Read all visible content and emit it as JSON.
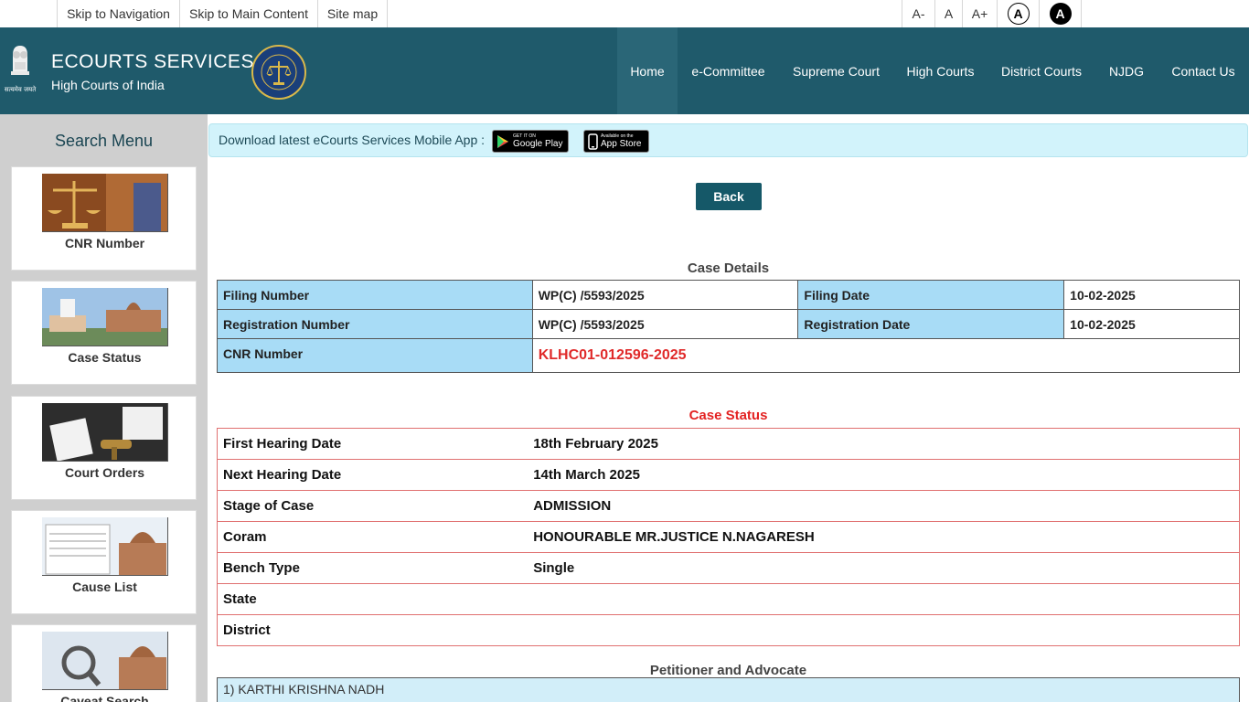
{
  "topbar": {
    "skip_navigation": "Skip to Navigation",
    "skip_main": "Skip to Main Content",
    "site_map": "Site map",
    "font_decrease": "A-",
    "font_normal": "A",
    "font_increase": "A+",
    "contrast_normal": "A",
    "contrast_high": "A"
  },
  "header": {
    "title": "ECOURTS SERVICES",
    "subtitle": "High Courts of India",
    "emblem_caption": "सत्यमेव जयते",
    "nav": [
      "Home",
      "e-Committee",
      "Supreme Court",
      "High Courts",
      "District Courts",
      "NJDG",
      "Contact Us"
    ],
    "active_nav": "Home",
    "primary_color": "#1f5a6b"
  },
  "sidebar": {
    "title": "Search Menu",
    "items": [
      {
        "label": "CNR Number",
        "icon": "scales-of-justice-image"
      },
      {
        "label": "Case Status",
        "icon": "supreme-court-building-image"
      },
      {
        "label": "Court Orders",
        "icon": "gavel-document-image"
      },
      {
        "label": "Cause List",
        "icon": "court-list-image"
      },
      {
        "label": "Caveat Search",
        "icon": "magnifier-court-image"
      }
    ]
  },
  "banner": {
    "text": "Download latest eCourts Services Mobile App :",
    "google_play_small": "GET IT ON",
    "google_play_big": "Google Play",
    "app_store_small": "Available on the",
    "app_store_big": "App Store"
  },
  "back_label": "Back",
  "case_details": {
    "title": "Case Details",
    "filing_number_label": "Filing Number",
    "filing_number": "WP(C) /5593/2025",
    "filing_date_label": "Filing Date",
    "filing_date": "10-02-2025",
    "registration_number_label": "Registration Number",
    "registration_number": "WP(C) /5593/2025",
    "registration_date_label": "Registration Date",
    "registration_date": "10-02-2025",
    "cnr_label": "CNR Number",
    "cnr": "KLHC01-012596-2025"
  },
  "case_status": {
    "title": "Case Status",
    "rows": [
      {
        "label": "First Hearing Date",
        "value": "18th February 2025"
      },
      {
        "label": "Next Hearing Date",
        "value": "14th March 2025"
      },
      {
        "label": "Stage of Case",
        "value": "ADMISSION"
      },
      {
        "label": "Coram",
        "value": "HONOURABLE MR.JUSTICE N.NAGARESH"
      },
      {
        "label": "Bench Type",
        "value": "Single"
      },
      {
        "label": "State",
        "value": ""
      },
      {
        "label": "District",
        "value": ""
      }
    ]
  },
  "petitioner": {
    "title": "Petitioner and Advocate",
    "first": "1) KARTHI KRISHNA NADH"
  }
}
